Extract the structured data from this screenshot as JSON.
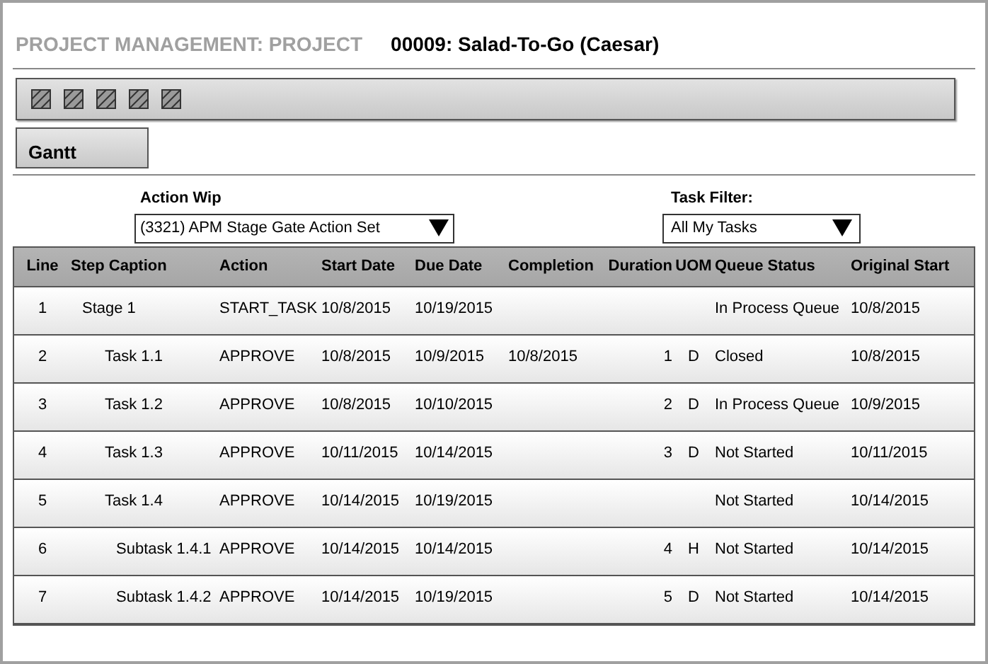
{
  "header": {
    "module": "PROJECT MANAGEMENT: PROJECT",
    "project": "00009: Salad-To-Go (Caesar)"
  },
  "toolbar": {
    "icons": [
      {
        "kind": "placeholder"
      },
      {
        "kind": "placeholder"
      },
      {
        "kind": "placeholder"
      },
      {
        "kind": "placeholder"
      },
      {
        "kind": "placeholder"
      }
    ]
  },
  "gantt_button": "Gantt",
  "action_wip": {
    "label": "Action Wip",
    "value": "(3321) APM Stage Gate Action Set"
  },
  "task_filter": {
    "label": "Task Filter:",
    "value": "All My Tasks"
  },
  "table": {
    "columns": [
      "Line",
      "Step Caption",
      "Action",
      "Start Date",
      "Due Date",
      "Completion",
      "Duration",
      "UOM",
      "Queue Status",
      "Original Start"
    ],
    "rows": [
      {
        "line": "1",
        "caption": "Stage 1",
        "action": "START_TASK",
        "start": "10/8/2015",
        "due": "10/19/2015",
        "status": "In Process Queue",
        "original": "10/8/2015",
        "children": [
          {
            "line": "2",
            "caption": "Task 1.1",
            "action": "APPROVE",
            "start": "10/8/2015",
            "due": "10/9/2015",
            "completion": "10/8/2015",
            "duration": "1",
            "uom": "D",
            "status": "Closed",
            "original": "10/8/2015"
          },
          {
            "line": "3",
            "caption": "Task 1.2",
            "action": "APPROVE",
            "start": "10/8/2015",
            "due": "10/10/2015",
            "duration": "2",
            "uom": "D",
            "status": "In Process Queue",
            "original": "10/9/2015"
          },
          {
            "line": "4",
            "caption": "Task 1.3",
            "action": "APPROVE",
            "start": "10/11/2015",
            "due": "10/14/2015",
            "duration": "3",
            "uom": "D",
            "status": "Not Started",
            "original": "10/11/2015"
          },
          {
            "line": "5",
            "caption": "Task 1.4",
            "action": "APPROVE",
            "start": "10/14/2015",
            "due": "10/19/2015",
            "status": "Not Started",
            "original": "10/14/2015",
            "children": [
              {
                "line": "6",
                "caption": "Subtask 1.4.1",
                "action": "APPROVE",
                "start": "10/14/2015",
                "due": "10/14/2015",
                "duration": "4",
                "uom": "H",
                "status": "Not Started",
                "original": "10/14/2015"
              },
              {
                "line": "7",
                "caption": "Subtask 1.4.2",
                "action": "APPROVE",
                "start": "10/14/2015",
                "due": "10/19/2015",
                "duration": "5",
                "uom": "D",
                "status": "Not Started",
                "original": "10/14/2015"
              }
            ]
          }
        ]
      }
    ]
  }
}
